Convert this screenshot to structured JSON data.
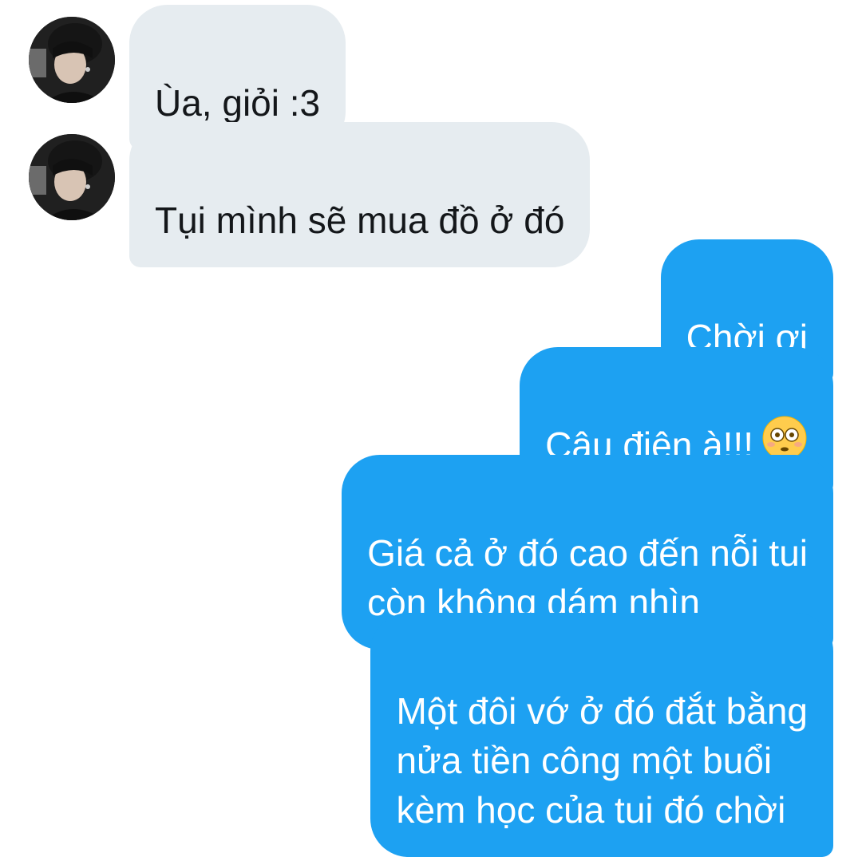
{
  "conversation": {
    "messages": [
      {
        "sender": "other",
        "text": "Ùa, giỏi :3"
      },
      {
        "sender": "other",
        "text": "Tụi mình sẽ mua đồ ở đó"
      },
      {
        "sender": "me",
        "text": "Chời ơi"
      },
      {
        "sender": "me",
        "text": "Cậu điên à!!!",
        "emoji": "flushed-face-emoji"
      },
      {
        "sender": "me",
        "text": "Giá cả ở đó cao đến nỗi tui\ncòn không dám nhìn"
      },
      {
        "sender": "me",
        "text": "Một đôi vớ ở đó đắt bằng\nnửa tiền công một buổi\nkèm học của tui đó chời"
      }
    ]
  },
  "colors": {
    "incoming_bubble": "#e6ecf0",
    "outgoing_bubble": "#1da1f2",
    "incoming_text": "#14171a",
    "outgoing_text": "#ffffff",
    "background": "#ffffff"
  }
}
